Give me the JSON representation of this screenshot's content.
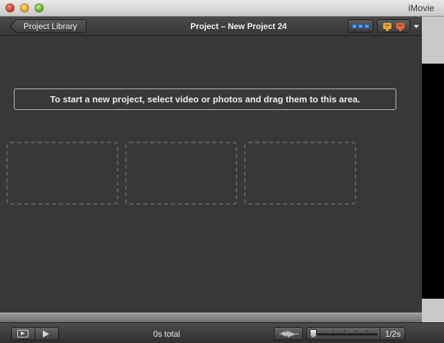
{
  "window": {
    "app_name": "iMovie"
  },
  "header": {
    "back_button_label": "Project Library",
    "project_title": "Project – New Project 24",
    "view_toggle_icon": "thumbnail-view-icon",
    "comment_icons": [
      "comment-marker-icon",
      "chapter-marker-icon"
    ]
  },
  "main": {
    "instruction": "To start a new project, select video or photos and drag them to this area.",
    "drop_slot_count": 3
  },
  "footer": {
    "total_label": "0s total",
    "duration_label": "1/2s",
    "play_full_icon": "play-fullscreen-icon",
    "play_icon": "play-icon",
    "audio_icon": "audio-waveform-icon"
  },
  "colors": {
    "background": "#383838",
    "accent_blue": "#5b9af0",
    "marker_orange": "#e8a13a"
  }
}
